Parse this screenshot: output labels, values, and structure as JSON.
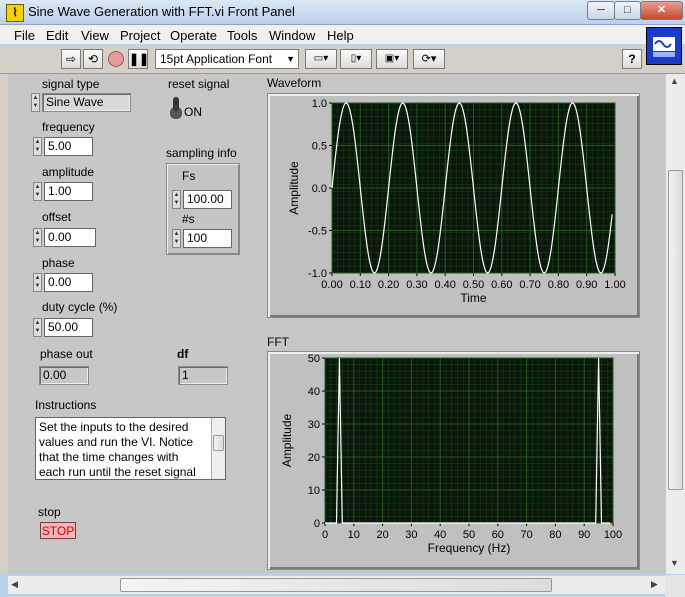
{
  "window": {
    "title": "Sine Wave Generation with FFT.vi Front Panel",
    "minimize": "─",
    "maximize": "□",
    "close": "✕"
  },
  "menu": [
    "File",
    "Edit",
    "View",
    "Project",
    "Operate",
    "Tools",
    "Window",
    "Help"
  ],
  "toolbar": {
    "font": "15pt Application Font",
    "help": "?",
    "icons": [
      "run-arrow-icon",
      "run-continuously-icon",
      "abort-icon",
      "pause-icon",
      "align-icon",
      "distribute-icon",
      "resize-icon",
      "reorder-icon"
    ]
  },
  "controls": {
    "signal_type": {
      "label": "signal type",
      "value": "Sine Wave"
    },
    "reset_signal": {
      "label": "reset signal",
      "state": "ON"
    },
    "frequency": {
      "label": "frequency",
      "value": "5.00"
    },
    "amplitude": {
      "label": "amplitude",
      "value": "1.00"
    },
    "offset": {
      "label": "offset",
      "value": "0.00"
    },
    "phase": {
      "label": "phase",
      "value": "0.00"
    },
    "duty_cycle": {
      "label": "duty cycle (%)",
      "value": "50.00"
    },
    "sampling_info": {
      "label": "sampling info",
      "fs_label": "Fs",
      "fs_value": "100.00",
      "ns_label": "#s",
      "ns_value": "100"
    },
    "phase_out": {
      "label": "phase out",
      "value": "0.00"
    },
    "df": {
      "label": "df",
      "value": "1"
    },
    "instructions": {
      "label": "Instructions",
      "text": "Set the inputs to the desired values and run the VI.  Notice that the time changes with each run until the reset signal"
    },
    "stop": {
      "label": "stop",
      "button": "STOP"
    }
  },
  "chart_data": [
    {
      "type": "line",
      "title": "Waveform",
      "xlabel": "Time",
      "ylabel": "Amplitude",
      "xlim": [
        0,
        1
      ],
      "ylim": [
        -1,
        1
      ],
      "x_ticks": [
        "0.00",
        "0.10",
        "0.20",
        "0.30",
        "0.40",
        "0.50",
        "0.60",
        "0.70",
        "0.80",
        "0.90",
        "1.00"
      ],
      "y_ticks": [
        "1.0",
        "0.5",
        "0.0",
        "-0.5",
        "-1.0"
      ],
      "grid": true,
      "series": [
        {
          "function": "sine",
          "frequency": 5,
          "amplitude": 1,
          "samples": 100,
          "color": "#ffffff"
        }
      ]
    },
    {
      "type": "line",
      "title": "FFT",
      "xlabel": "Frequency (Hz)",
      "ylabel": "Amplitude",
      "xlim": [
        0,
        100
      ],
      "ylim": [
        0,
        50
      ],
      "x_ticks": [
        "0",
        "10",
        "20",
        "30",
        "40",
        "50",
        "60",
        "70",
        "80",
        "90",
        "100"
      ],
      "y_ticks": [
        "50",
        "40",
        "30",
        "20",
        "10",
        "0"
      ],
      "grid": true,
      "series": [
        {
          "x": [
            0,
            4,
            5,
            6,
            94,
            95,
            96,
            99
          ],
          "y": [
            0,
            0,
            50,
            0,
            0,
            50,
            0,
            0
          ],
          "color": "#ffffff"
        }
      ]
    }
  ],
  "colors": {
    "plot_bg": "#0b170b",
    "grid": "#1f5a1f",
    "panel": "#c7c7c7",
    "stop_text": "#d20000"
  }
}
